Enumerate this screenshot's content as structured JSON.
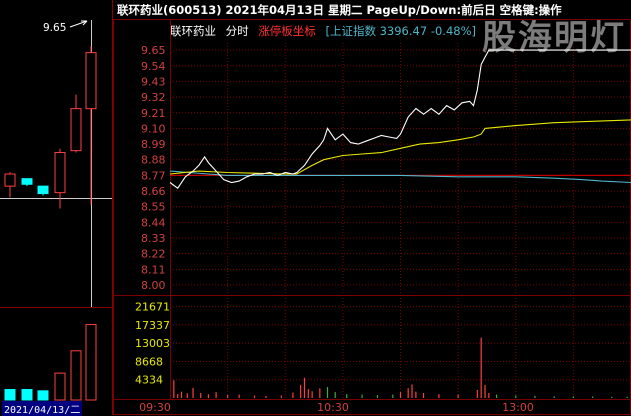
{
  "header": {
    "title": "联环药业(600513)  2021年04月13日 星期二 PageUp/Down:前后日 空格键:操作",
    "watermark": "股海明灯"
  },
  "legend": {
    "stock": "联环药业",
    "mode": "分时",
    "limit_label": "涨停板坐标",
    "index_label": "[上证指数 3396.47 -0.48%]"
  },
  "left_panel": {
    "high_label": "9.65",
    "date_label": "2021/04/13/二"
  },
  "colors": {
    "price": "#ffffff",
    "avg_price": "#e8e800",
    "index": "#4fb5c8",
    "grid": "#7a0000",
    "up": "#ff4040",
    "down": "#00ffff",
    "tick": "#d04040",
    "volume_tick": "#e8e800"
  },
  "chart_data": {
    "type": "line",
    "title": "联环药业 分时",
    "price_ticks": [
      "9.65",
      "9.54",
      "9.43",
      "9.32",
      "9.21",
      "9.10",
      "8.99",
      "8.88",
      "8.77",
      "8.66",
      "8.55",
      "8.44",
      "8.33",
      "8.22",
      "8.11",
      "8.00"
    ],
    "price_ylim": [
      8.0,
      9.7
    ],
    "volume_ticks": [
      "21671",
      "17337",
      "13003",
      "8668",
      "4334"
    ],
    "volume_ylim": [
      0,
      23000
    ],
    "x_ticks": [
      "09:30",
      "10:30",
      "13:00"
    ],
    "series": [
      {
        "name": "price",
        "points": [
          [
            0,
            8.72
          ],
          [
            4,
            8.68
          ],
          [
            8,
            8.76
          ],
          [
            12,
            8.8
          ],
          [
            15,
            8.84
          ],
          [
            18,
            8.9
          ],
          [
            20,
            8.86
          ],
          [
            24,
            8.8
          ],
          [
            28,
            8.74
          ],
          [
            32,
            8.72
          ],
          [
            36,
            8.73
          ],
          [
            40,
            8.76
          ],
          [
            44,
            8.78
          ],
          [
            48,
            8.78
          ],
          [
            52,
            8.79
          ],
          [
            56,
            8.77
          ],
          [
            60,
            8.79
          ],
          [
            64,
            8.78
          ],
          [
            66,
            8.79
          ],
          [
            70,
            8.84
          ],
          [
            74,
            8.92
          ],
          [
            78,
            8.98
          ],
          [
            80,
            9.02
          ],
          [
            82,
            9.1
          ],
          [
            86,
            9.02
          ],
          [
            90,
            9.06
          ],
          [
            94,
            9.0
          ],
          [
            98,
            8.99
          ],
          [
            102,
            9.01
          ],
          [
            106,
            9.03
          ],
          [
            110,
            9.05
          ],
          [
            114,
            9.04
          ],
          [
            118,
            9.03
          ],
          [
            120,
            9.06
          ],
          [
            124,
            9.18
          ],
          [
            128,
            9.24
          ],
          [
            132,
            9.2
          ],
          [
            136,
            9.24
          ],
          [
            140,
            9.2
          ],
          [
            144,
            9.26
          ],
          [
            148,
            9.23
          ],
          [
            152,
            9.28
          ],
          [
            156,
            9.29
          ],
          [
            158,
            9.26
          ],
          [
            160,
            9.37
          ],
          [
            162,
            9.55
          ],
          [
            164,
            9.6
          ],
          [
            166,
            9.65
          ],
          [
            240,
            9.65
          ]
        ]
      },
      {
        "name": "avg_price",
        "points": [
          [
            0,
            8.78
          ],
          [
            15,
            8.8
          ],
          [
            30,
            8.79
          ],
          [
            60,
            8.78
          ],
          [
            66,
            8.78
          ],
          [
            74,
            8.84
          ],
          [
            80,
            8.88
          ],
          [
            90,
            8.91
          ],
          [
            100,
            8.92
          ],
          [
            110,
            8.93
          ],
          [
            120,
            8.96
          ],
          [
            130,
            8.99
          ],
          [
            140,
            9.0
          ],
          [
            150,
            9.02
          ],
          [
            158,
            9.04
          ],
          [
            162,
            9.06
          ],
          [
            164,
            9.1
          ],
          [
            180,
            9.12
          ],
          [
            200,
            9.14
          ],
          [
            220,
            9.15
          ],
          [
            240,
            9.16
          ]
        ]
      },
      {
        "name": "index",
        "points": [
          [
            0,
            8.8
          ],
          [
            10,
            8.79
          ],
          [
            20,
            8.78
          ],
          [
            30,
            8.77
          ],
          [
            60,
            8.77
          ],
          [
            90,
            8.77
          ],
          [
            120,
            8.77
          ],
          [
            150,
            8.76
          ],
          [
            180,
            8.76
          ],
          [
            200,
            8.75
          ],
          [
            215,
            8.74
          ],
          [
            225,
            8.73
          ],
          [
            240,
            8.72
          ]
        ]
      }
    ],
    "volume_series": {
      "name": "volume",
      "points": [
        [
          2,
          4200
        ],
        [
          4,
          900
        ],
        [
          6,
          1500
        ],
        [
          9,
          1100
        ],
        [
          12,
          2400
        ],
        [
          16,
          1200
        ],
        [
          20,
          900
        ],
        [
          24,
          1400
        ],
        [
          30,
          700
        ],
        [
          36,
          800
        ],
        [
          44,
          600
        ],
        [
          50,
          500
        ],
        [
          58,
          600
        ],
        [
          64,
          1300
        ],
        [
          68,
          3100
        ],
        [
          70,
          4800
        ],
        [
          72,
          2100
        ],
        [
          74,
          1600
        ],
        [
          78,
          2300
        ],
        [
          82,
          2600
        ],
        [
          86,
          1400
        ],
        [
          92,
          900
        ],
        [
          100,
          800
        ],
        [
          108,
          700
        ],
        [
          116,
          800
        ],
        [
          120,
          1400
        ],
        [
          124,
          2300
        ],
        [
          126,
          3200
        ],
        [
          128,
          1500
        ],
        [
          132,
          1200
        ],
        [
          140,
          900
        ],
        [
          150,
          800
        ],
        [
          160,
          1900
        ],
        [
          162,
          14300
        ],
        [
          164,
          3100
        ],
        [
          166,
          1200
        ],
        [
          170,
          800
        ],
        [
          180,
          600
        ],
        [
          190,
          500
        ],
        [
          200,
          400
        ],
        [
          210,
          400
        ],
        [
          220,
          350
        ],
        [
          230,
          300
        ],
        [
          238,
          300
        ]
      ]
    }
  },
  "left_chart": {
    "ylim": [
      7.0,
      10.0
    ],
    "candles": [
      {
        "open": 8.22,
        "close": 8.35,
        "high": 8.37,
        "low": 8.1,
        "color": "up"
      },
      {
        "open": 8.3,
        "close": 8.24,
        "high": 8.3,
        "low": 8.22,
        "color": "down"
      },
      {
        "open": 8.22,
        "close": 8.14,
        "high": 8.22,
        "low": 8.12,
        "color": "down"
      },
      {
        "open": 8.15,
        "close": 8.58,
        "high": 8.62,
        "low": 7.98,
        "color": "up"
      },
      {
        "open": 8.6,
        "close": 9.05,
        "high": 9.2,
        "low": 8.58,
        "color": "up"
      },
      {
        "open": 9.05,
        "close": 9.65,
        "high": 9.72,
        "low": 8.02,
        "color": "up"
      }
    ],
    "volumes": [
      {
        "value": 3200,
        "color": "down"
      },
      {
        "value": 3200,
        "color": "down"
      },
      {
        "value": 2800,
        "color": "down"
      },
      {
        "value": 8200,
        "color": "up"
      },
      {
        "value": 15000,
        "color": "up"
      },
      {
        "value": 23000,
        "color": "up"
      }
    ],
    "vol_max": 25000
  }
}
